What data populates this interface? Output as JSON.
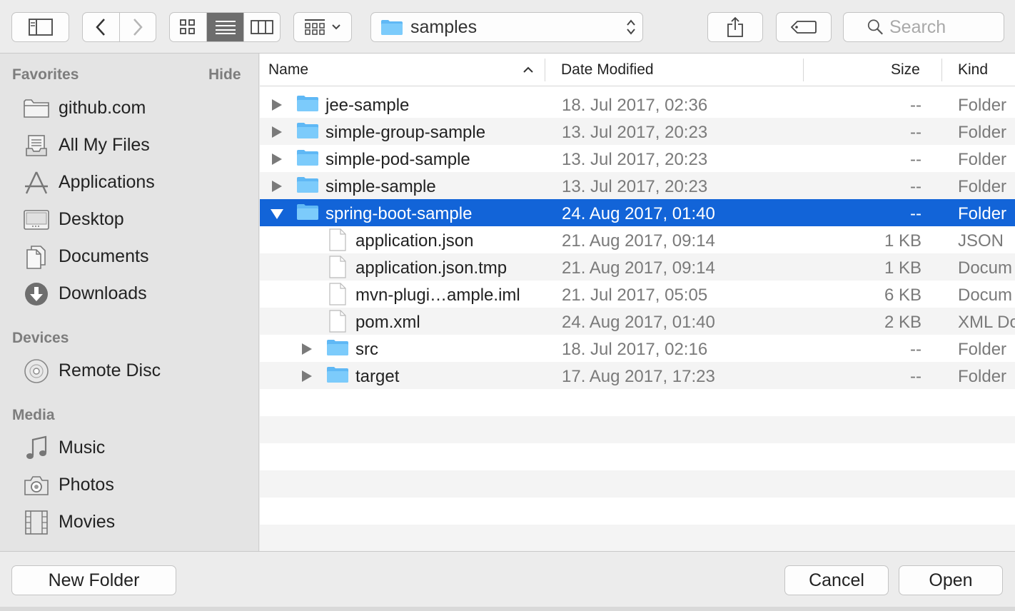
{
  "toolbar": {
    "path_label": "samples",
    "search_placeholder": "Search"
  },
  "sidebar": {
    "favorites_heading": "Favorites",
    "hide_label": "Hide",
    "favorites": [
      {
        "label": "github.com",
        "icon": "folder-icon"
      },
      {
        "label": "All My Files",
        "icon": "all-files-icon"
      },
      {
        "label": "Applications",
        "icon": "applications-icon"
      },
      {
        "label": "Desktop",
        "icon": "desktop-icon"
      },
      {
        "label": "Documents",
        "icon": "documents-icon"
      },
      {
        "label": "Downloads",
        "icon": "downloads-icon"
      }
    ],
    "devices_heading": "Devices",
    "devices": [
      {
        "label": "Remote Disc",
        "icon": "disc-icon"
      }
    ],
    "media_heading": "Media",
    "media": [
      {
        "label": "Music",
        "icon": "music-icon"
      },
      {
        "label": "Photos",
        "icon": "camera-icon"
      },
      {
        "label": "Movies",
        "icon": "film-icon"
      }
    ]
  },
  "list": {
    "columns": {
      "name": "Name",
      "date": "Date Modified",
      "size": "Size",
      "kind": "Kind"
    },
    "rows": [
      {
        "name": "jee-sample",
        "date": "18. Jul 2017, 02:36",
        "size": "--",
        "kind": "Folder"
      },
      {
        "name": "simple-group-sample",
        "date": "13. Jul 2017, 20:23",
        "size": "--",
        "kind": "Folder"
      },
      {
        "name": "simple-pod-sample",
        "date": "13. Jul 2017, 20:23",
        "size": "--",
        "kind": "Folder"
      },
      {
        "name": "simple-sample",
        "date": "13. Jul 2017, 20:23",
        "size": "--",
        "kind": "Folder"
      },
      {
        "name": "spring-boot-sample",
        "date": "24. Aug 2017, 01:40",
        "size": "--",
        "kind": "Folder"
      },
      {
        "name": "application.json",
        "date": "21. Aug 2017, 09:14",
        "size": "1 KB",
        "kind": "JSON"
      },
      {
        "name": "application.json.tmp",
        "date": "21. Aug 2017, 09:14",
        "size": "1 KB",
        "kind": "Docum"
      },
      {
        "name": "mvn-plugi…ample.iml",
        "date": "21. Jul 2017, 05:05",
        "size": "6 KB",
        "kind": "Docum"
      },
      {
        "name": "pom.xml",
        "date": "24. Aug 2017, 01:40",
        "size": "2 KB",
        "kind": "XML Do"
      },
      {
        "name": "src",
        "date": "18. Jul 2017, 02:16",
        "size": "--",
        "kind": "Folder"
      },
      {
        "name": "target",
        "date": "17. Aug 2017, 17:23",
        "size": "--",
        "kind": "Folder"
      }
    ]
  },
  "footer": {
    "new_folder": "New Folder",
    "cancel": "Cancel",
    "open": "Open"
  },
  "colors": {
    "selection": "#1264d8",
    "folder": "#5fb8f5"
  }
}
